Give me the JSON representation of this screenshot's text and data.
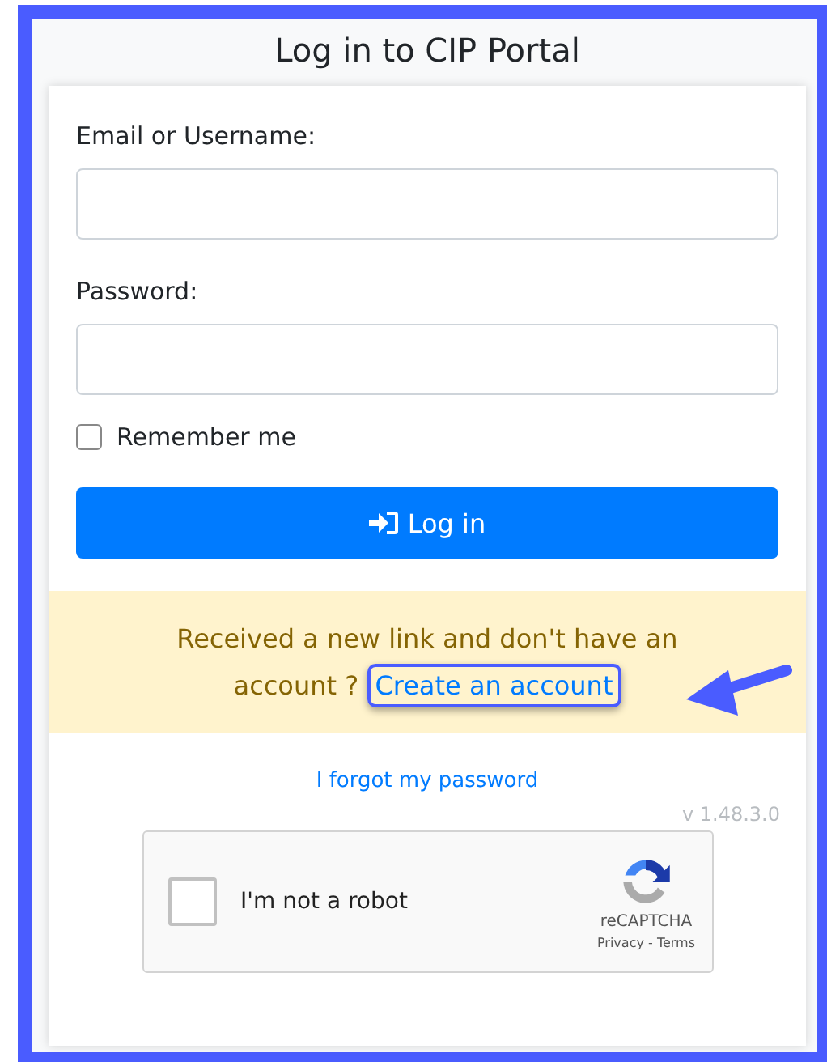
{
  "title": "Log in to CIP Portal",
  "fields": [
    {
      "label": "Email or Username:"
    },
    {
      "label": "Password:"
    }
  ],
  "remember": {
    "label": "Remember me",
    "checked": false
  },
  "login_button": {
    "label": "Log in"
  },
  "notice": {
    "text": "Received a new link and don't have an account ?",
    "link": "Create an account",
    "highlighted": true
  },
  "forgot_link": "I forgot my password",
  "version": "v 1.48.3.0",
  "captcha": {
    "label": "I'm not a robot",
    "checked": false,
    "brand": "reCAPTCHA",
    "privacy": "Privacy",
    "separator": "-",
    "terms": "Terms"
  }
}
